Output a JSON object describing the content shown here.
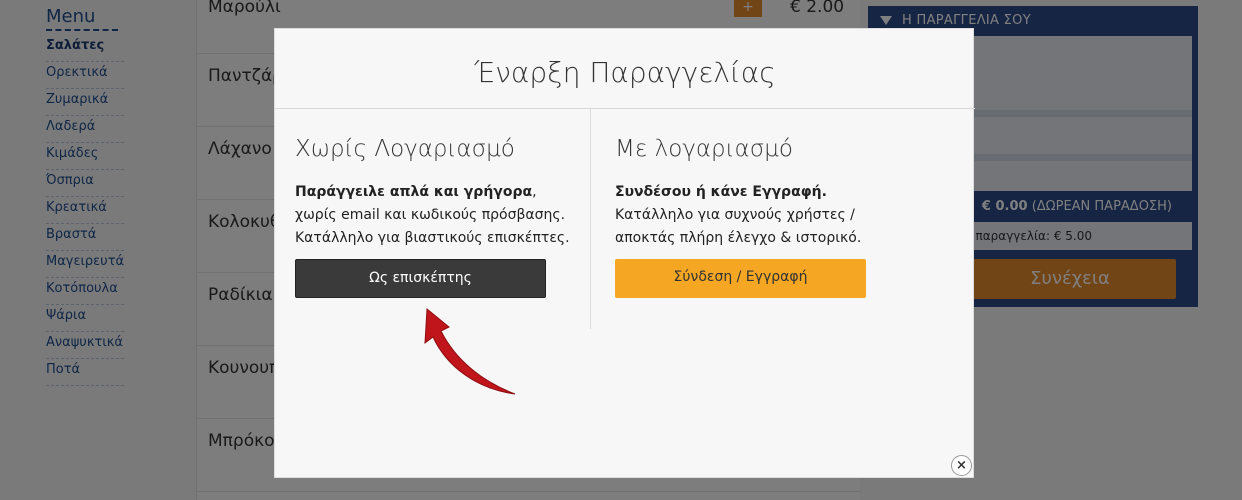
{
  "menu": {
    "title": "Menu",
    "items": [
      {
        "label": "Σαλάτες",
        "active": true
      },
      {
        "label": "Ορεκτικά"
      },
      {
        "label": "Ζυμαρικά"
      },
      {
        "label": "Λαδερά"
      },
      {
        "label": "Κιμάδες"
      },
      {
        "label": "Όσπρια"
      },
      {
        "label": "Κρεατικά"
      },
      {
        "label": "Βραστά"
      },
      {
        "label": "Μαγειρευτά"
      },
      {
        "label": "Κοτόπουλα"
      },
      {
        "label": "Ψάρια"
      },
      {
        "label": "Αναψυκτικά"
      },
      {
        "label": "Ποτά"
      }
    ]
  },
  "products": {
    "items": [
      {
        "name": "Μαρούλι",
        "price": "€ 2.00",
        "add": "+"
      },
      {
        "name": "Παντζάρ"
      },
      {
        "name": "Λάχανο"
      },
      {
        "name": "Κολοκυθ"
      },
      {
        "name": "Ραδίκια"
      },
      {
        "name": "Κουνουπ"
      },
      {
        "name": "Μπρόκο"
      }
    ]
  },
  "order": {
    "header": "Η ΠΑΡΑΓΓΕΛΙΑ ΣΟΥ",
    "total_amount": "€ 0.00",
    "total_note": "(ΔΩΡΕΑΝ ΠΑΡΑΔΟΣΗ)",
    "minimum": "παραγγελία: € 5.00",
    "continue_label": "Συνέχεια"
  },
  "modal": {
    "title": "Έναρξη Παραγγελίας",
    "guest": {
      "heading": "Χωρίς Λογαριασμό",
      "line_bold": "Παράγγειλε απλά και γρήγορα",
      "line_bold_suffix": ",",
      "line2": "χωρίς email και κωδικούς πρόσβασης.",
      "line3": "Κατάλληλο για βιαστικούς επισκέπτες.",
      "button": "Ως επισκέπτης"
    },
    "account": {
      "heading": "Με λογαριασμό",
      "line_bold": "Συνδέσου ή κάνε Εγγραφή.",
      "line2": "Κατάλληλο για συχνούς χρήστες /",
      "line3": "αποκτάς πλήρη έλεγχο & ιστορικό.",
      "button": "Σύνδεση / Εγγραφή"
    },
    "close": "×"
  },
  "colors": {
    "accent_orange": "#f5a623",
    "guest_button": "#3a3a3a",
    "arrow_red": "#c0161b",
    "panel_blue": "#2c4a86"
  }
}
